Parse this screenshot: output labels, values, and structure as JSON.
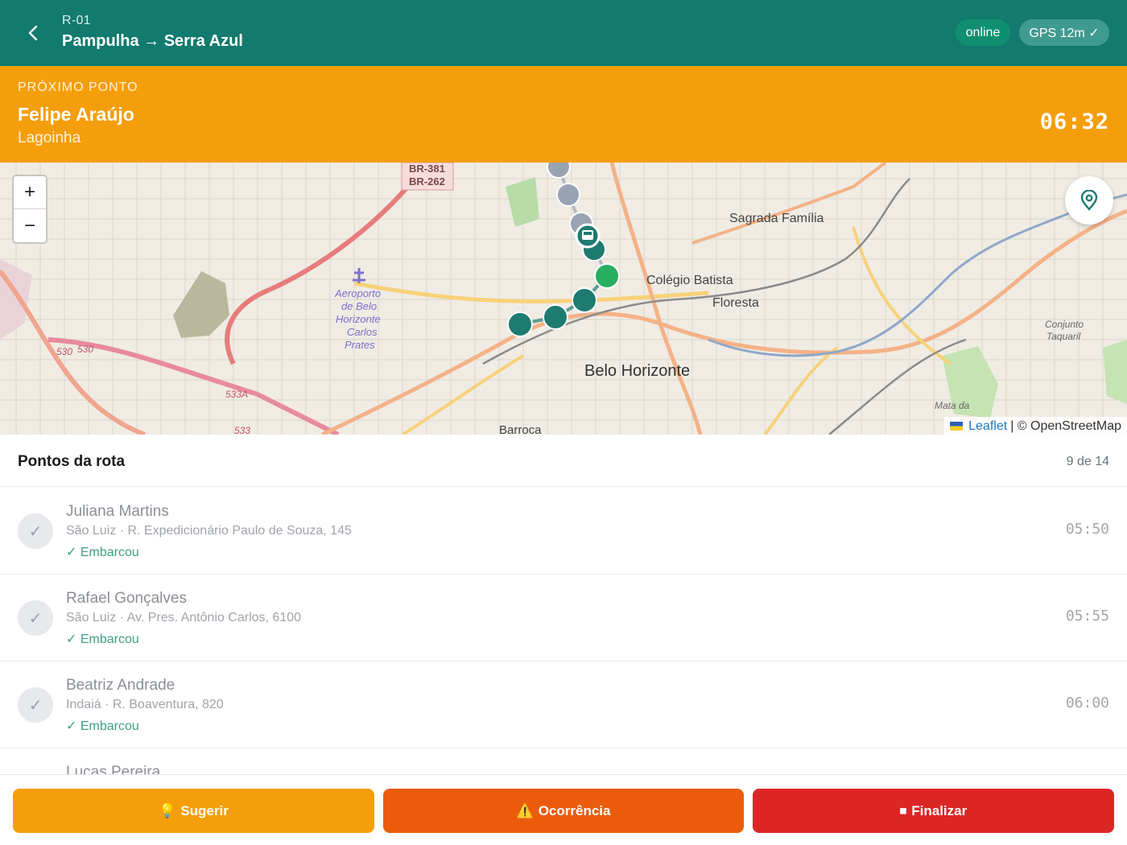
{
  "header": {
    "route_code": "R-01",
    "route_name": "Pampulha → Serra Azul",
    "online_label": "online",
    "gps_label": "GPS 12m ✓"
  },
  "next_stop": {
    "label": "PRÓXIMO PONTO",
    "name": "Felipe Araújo",
    "area": "Lagoinha",
    "time": "06:32"
  },
  "map": {
    "zoom_in": "+",
    "zoom_out": "−",
    "labels": {
      "br": "BR-381",
      "br2": "BR-262",
      "airport1": "Aeroporto",
      "airport2": "de Belo",
      "airport3": "Horizonte",
      "airport4": "Carlos",
      "airport5": "Prates",
      "sagrada": "Sagrada Família",
      "colegio": "Colégio Batista",
      "floresta": "Floresta",
      "bh": "Belo Horizonte",
      "barroca": "Barroca",
      "conjunto1": "Conjunto",
      "conjunto2": "Taquaril",
      "mata": "Mata da",
      "rod530": "530",
      "rod530b": "530",
      "rod533a": "533A",
      "rod533": "533"
    },
    "attribution_link": "Leaflet",
    "attribution_text": "| © OpenStreetMap"
  },
  "colors": {
    "header": "#127a6e",
    "accent": "#f59e0b",
    "danger": "#dc2626",
    "warning": "#ea5c0c",
    "stop_done": "#9aa3b2",
    "stop_current": "#1e7b70",
    "stop_next": "#27ae60"
  },
  "list": {
    "title": "Pontos da rota",
    "count": "9 de 14",
    "rows": [
      {
        "name": "Juliana Martins",
        "address": "São Luiz · R. Expedicionário Paulo de Souza, 145",
        "status": "✓ Embarcou",
        "time": "05:50"
      },
      {
        "name": "Rafael Gonçalves",
        "address": "São Luiz · Av. Pres. Antônio Carlos, 6100",
        "status": "✓ Embarcou",
        "time": "05:55"
      },
      {
        "name": "Beatriz Andrade",
        "address": "Indaiá · R. Boaventura, 820",
        "status": "✓ Embarcou",
        "time": "06:00"
      },
      {
        "name": "Lucas Pereira"
      }
    ]
  },
  "actions": {
    "suggest": "Sugerir",
    "suggest_icon": "💡",
    "incident": "Ocorrência",
    "incident_icon": "⚠️",
    "finish": "Finalizar",
    "finish_icon": "⏹"
  }
}
